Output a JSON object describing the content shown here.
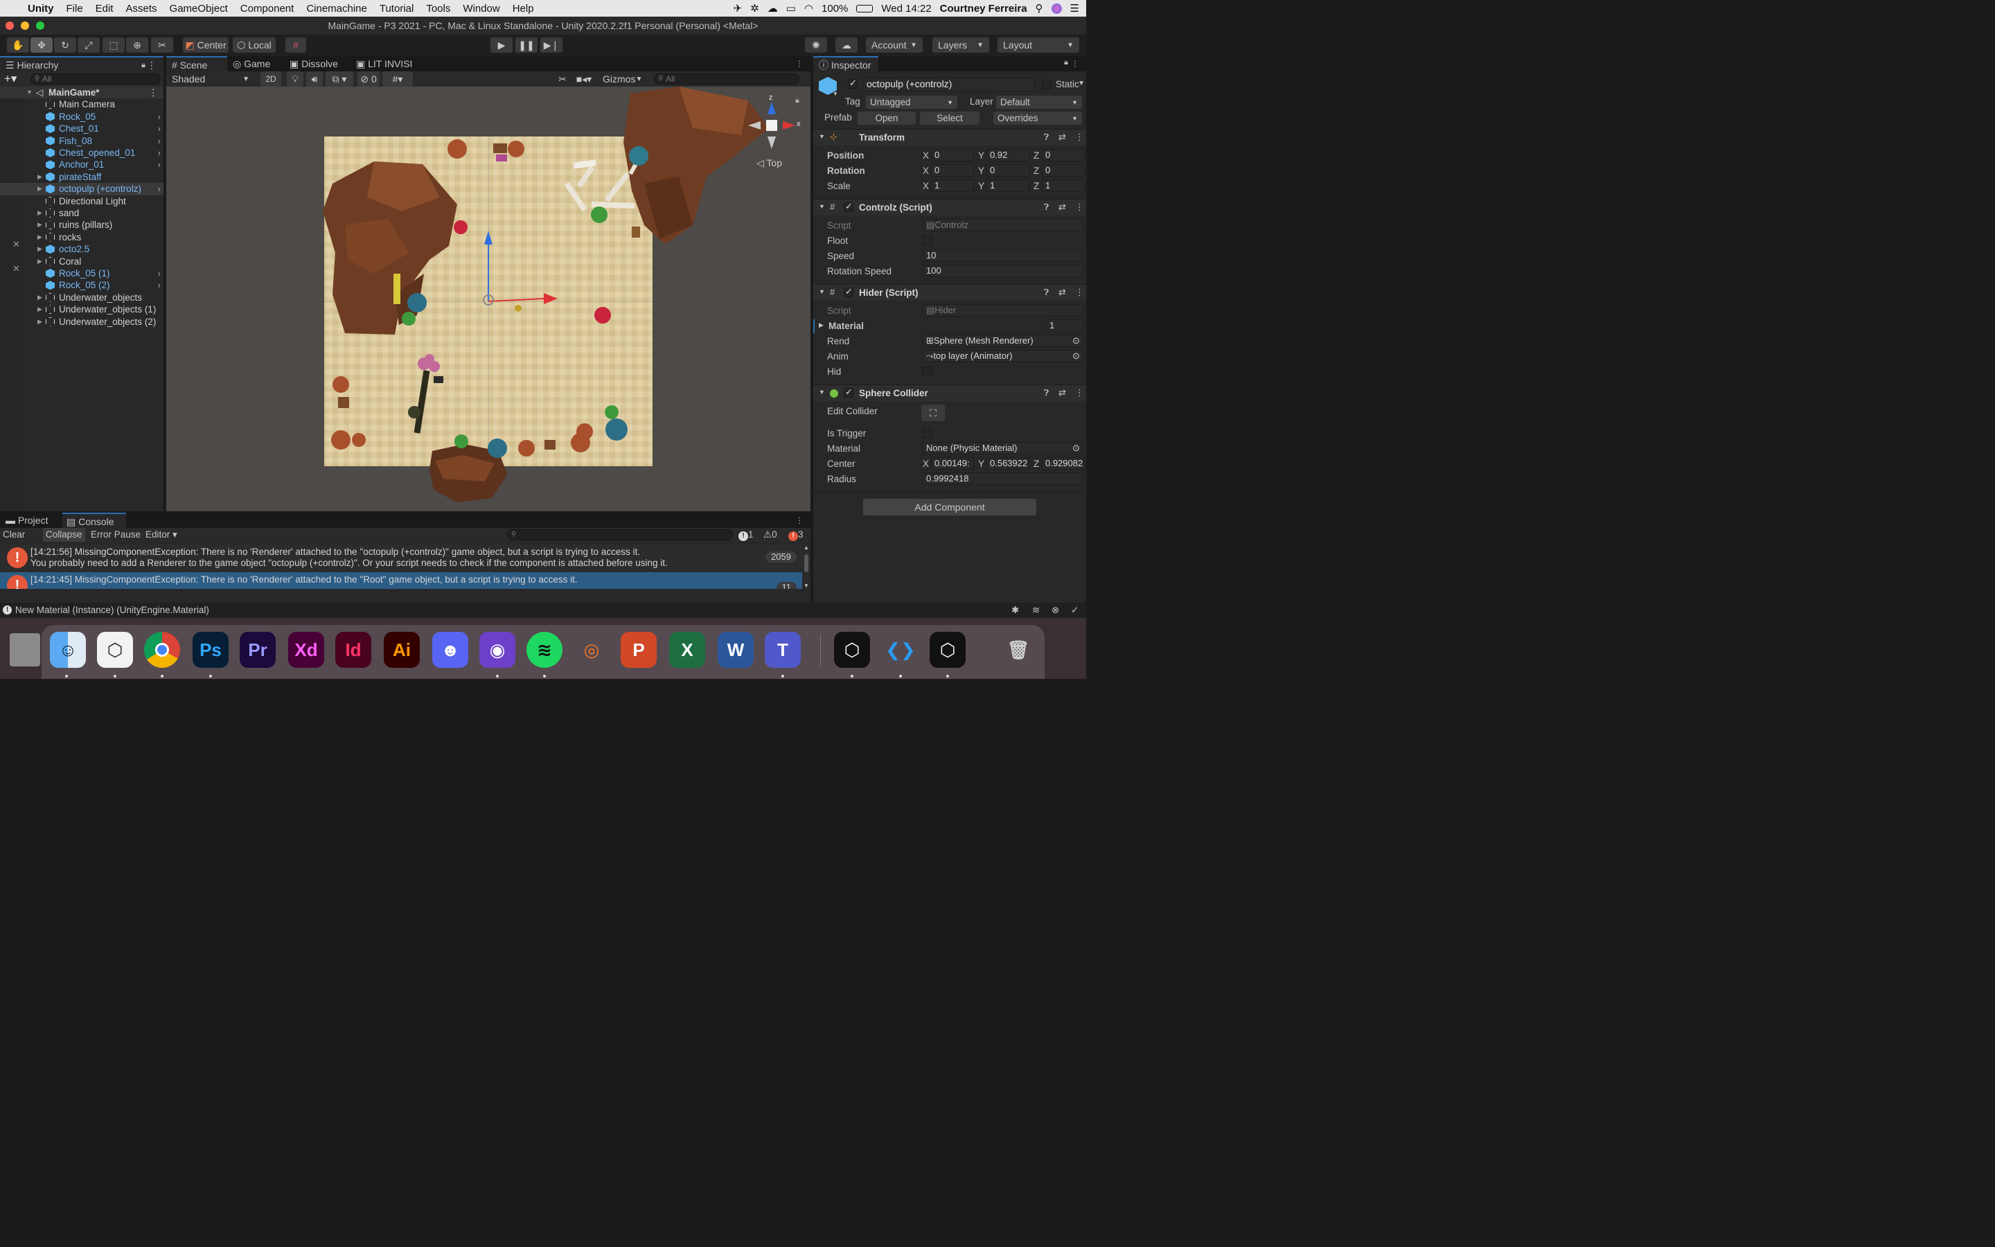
{
  "menubar": {
    "app": "Unity",
    "items": [
      "File",
      "Edit",
      "Assets",
      "GameObject",
      "Component",
      "Cinemachine",
      "Tutorial",
      "Tools",
      "Window",
      "Help"
    ],
    "battery": "100%",
    "clock": "Wed 14:22",
    "user": "Courtney Ferreira"
  },
  "window": {
    "title": "MainGame - P3 2021 - PC, Mac & Linux Standalone - Unity 2020.2.2f1 Personal (Personal) <Metal>"
  },
  "toolbar": {
    "pivot": "Center",
    "space": "Local",
    "account": "Account",
    "layers": "Layers",
    "layout": "Layout"
  },
  "hierarchy": {
    "tab": "Hierarchy",
    "search_placeholder": "All",
    "scene": "MainGame*",
    "items": [
      {
        "label": "Main Camera",
        "type": "object"
      },
      {
        "label": "Rock_05",
        "type": "prefab"
      },
      {
        "label": "Chest_01",
        "type": "prefab"
      },
      {
        "label": "Fish_08",
        "type": "prefab"
      },
      {
        "label": "Chest_opened_01",
        "type": "prefab"
      },
      {
        "label": "Anchor_01",
        "type": "prefab"
      },
      {
        "label": "pirateStaff",
        "type": "prefab"
      },
      {
        "label": "octopulp (+controlz)",
        "type": "prefab"
      },
      {
        "label": "Directional Light",
        "type": "object"
      },
      {
        "label": "sand",
        "type": "object"
      },
      {
        "label": "ruins (pillars)",
        "type": "object"
      },
      {
        "label": "rocks",
        "type": "object"
      },
      {
        "label": "octo2.5",
        "type": "prefab"
      },
      {
        "label": "Coral",
        "type": "object"
      },
      {
        "label": "Rock_05 (1)",
        "type": "prefab"
      },
      {
        "label": "Rock_05 (2)",
        "type": "prefab"
      },
      {
        "label": "Underwater_objects",
        "type": "object"
      },
      {
        "label": "Underwater_objects (1)",
        "type": "object"
      },
      {
        "label": "Underwater_objects (2)",
        "type": "object"
      }
    ]
  },
  "scene": {
    "tabs": [
      "Scene",
      "Game",
      "Dissolve",
      "LIT INVISI"
    ],
    "shading": "Shaded",
    "mode2d": "2D",
    "hidden_count": "0",
    "gizmos": "Gizmos",
    "search_placeholder": "All",
    "view_label": "Top",
    "axis_z": "z",
    "axis_x": "x"
  },
  "inspector": {
    "tab": "Inspector",
    "object_name": "octopulp (+controlz)",
    "static": "Static",
    "tag_label": "Tag",
    "tag": "Untagged",
    "layer_label": "Layer",
    "layer": "Default",
    "prefab_label": "Prefab",
    "open": "Open",
    "select": "Select",
    "overrides": "Overrides",
    "transform": {
      "title": "Transform",
      "position": {
        "label": "Position",
        "x": "0",
        "y": "0.92",
        "z": "0"
      },
      "rotation": {
        "label": "Rotation",
        "x": "0",
        "y": "0",
        "z": "0"
      },
      "scale": {
        "label": "Scale",
        "x": "1",
        "y": "1",
        "z": "1"
      }
    },
    "controlz": {
      "title": "Controlz (Script)",
      "script_label": "Script",
      "script": "Controlz",
      "floot_label": "Floot",
      "speed_label": "Speed",
      "speed": "10",
      "rotspeed_label": "Rotation Speed",
      "rotspeed": "100"
    },
    "hider": {
      "title": "Hider (Script)",
      "script_label": "Script",
      "script": "Hider",
      "material_label": "Material",
      "material_count": "1",
      "rend_label": "Rend",
      "rend": "Sphere (Mesh Renderer)",
      "anim_label": "Anim",
      "anim": "top layer (Animator)",
      "hid_label": "Hid"
    },
    "collider": {
      "title": "Sphere Collider",
      "edit_label": "Edit Collider",
      "trigger_label": "Is Trigger",
      "material_label": "Material",
      "material": "None (Physic Material)",
      "center_label": "Center",
      "cx": "0.00149:",
      "cy": "0.563922",
      "cz": "0.929082",
      "radius_label": "Radius",
      "radius": "0.9992418"
    },
    "add_component": "Add Component"
  },
  "console": {
    "tabs": [
      "Project",
      "Console"
    ],
    "clear": "Clear",
    "collapse": "Collapse",
    "error_pause": "Error Pause",
    "editor": "Editor",
    "count_info": "1",
    "count_warn": "0",
    "count_err": "3",
    "rows": [
      {
        "line1": "[14:21:56] MissingComponentException: There is no 'Renderer' attached to the \"octopulp (+controlz)\" game object, but a script is trying to access it.",
        "line2": "You probably need to add a Renderer to the game object \"octopulp (+controlz)\". Or your script needs to check if the component is attached before using it.",
        "count": "2059"
      },
      {
        "line1": "[14:21:45] MissingComponentException: There is no 'Renderer' attached to the \"Root\" game object, but a script is trying to access it.",
        "line2": "",
        "count": "11"
      }
    ]
  },
  "status": {
    "text": "New Material (Instance) (UnityEngine.Material)"
  },
  "dock": {
    "apps": [
      "Finder",
      "Unity Hub",
      "Chrome",
      "Photoshop",
      "Premiere",
      "Adobe XD",
      "InDesign",
      "Illustrator",
      "Discord",
      "GitHub Desktop",
      "Spotify",
      "Blender",
      "PowerPoint",
      "Excel",
      "Word",
      "Teams",
      "Unity",
      "VS Code",
      "Unity",
      "Trash"
    ]
  },
  "colors": {
    "accent": "#2d6fb3",
    "prefab_text": "#7ab8f5",
    "sand": "#d9c79a",
    "rock": "#6e3c22",
    "error": "#e4583b"
  }
}
